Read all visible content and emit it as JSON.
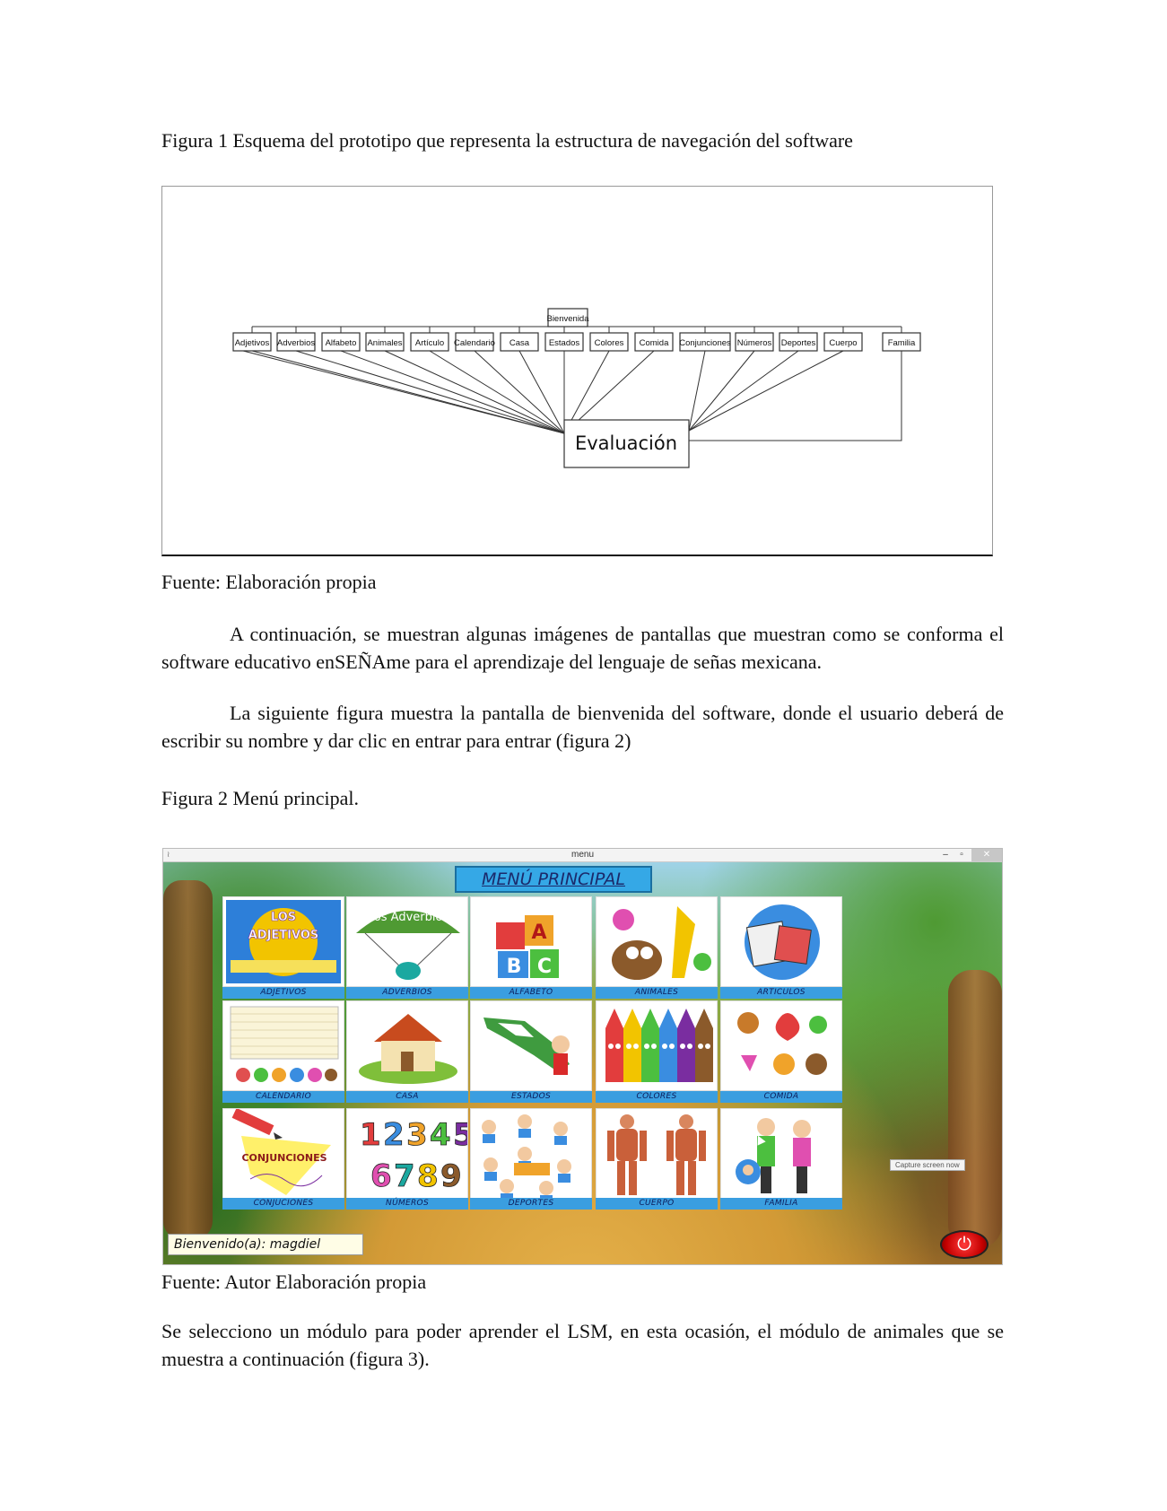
{
  "figure1": {
    "caption": "Figura 1 Esquema del prototipo que representa la estructura de navegación del software",
    "root": "Bienvenida",
    "modules": [
      "Adjetivos",
      "Adverbios",
      "Alfabeto",
      "Animales",
      "Artículo",
      "Calendario",
      "Casa",
      "Estados",
      "Colores",
      "Comida",
      "Conjunciones",
      "Números",
      "Deportes",
      "Cuerpo",
      "Familia"
    ],
    "evaluation": "Evaluación",
    "source": "Fuente: Elaboración propia"
  },
  "paragraphs": {
    "p1": "A continuación, se muestran algunas imágenes de pantallas que muestran como se conforma el software educativo enSEÑAme para el aprendizaje del lenguaje de señas mexicana.",
    "p2": "La siguiente figura muestra la pantalla de bienvenida del software, donde el usuario deberá de escribir su nombre y dar clic en entrar para entrar (figura 2)",
    "p3": "Se selecciono un módulo para poder aprender el LSM, en esta ocasión, el módulo de animales que se  muestra a continuación (figura 3)."
  },
  "figure2": {
    "caption": "Figura 2 Menú principal.",
    "window_title": "menu",
    "window_controls": {
      "minimize": "–",
      "maximize": "▫",
      "close": "✕"
    },
    "menu_title": "MENÚ PRINCIPAL",
    "tiles": [
      {
        "label": "ADJETIVOS",
        "art_text": "LOS ADJETIVOS",
        "icon": "adjectives-icon"
      },
      {
        "label": "ADVERBIOS",
        "art_text": "Los Adverbios",
        "icon": "parachute-icon"
      },
      {
        "label": "ALFABETO",
        "art_text": "ABC",
        "icon": "abc-blocks-icon"
      },
      {
        "label": "ANIMALES",
        "art_text": "",
        "icon": "animals-icon"
      },
      {
        "label": "ARTICULOS",
        "art_text": "",
        "icon": "articles-icon"
      },
      {
        "label": "CALENDARIO",
        "art_text": "",
        "icon": "calendar-icon"
      },
      {
        "label": "CASA",
        "art_text": "",
        "icon": "house-icon"
      },
      {
        "label": "ESTADOS",
        "art_text": "",
        "icon": "mexico-map-icon"
      },
      {
        "label": "COLORES",
        "art_text": "",
        "icon": "crayons-icon"
      },
      {
        "label": "COMIDA",
        "art_text": "",
        "icon": "food-icon"
      },
      {
        "label": "CONJUCIONES",
        "art_text": "CONJUNCIONES",
        "icon": "pencil-icon"
      },
      {
        "label": "NÚMEROS",
        "art_text": "123456789",
        "icon": "numbers-icon"
      },
      {
        "label": "DEPORTES",
        "art_text": "",
        "icon": "sports-icon"
      },
      {
        "label": "CUERPO",
        "art_text": "",
        "icon": "body-icon"
      },
      {
        "label": "FAMILIA",
        "art_text": "",
        "icon": "family-icon"
      }
    ],
    "welcome": "Bienvenido(a): magdiel",
    "tooltip": "Capture screen now",
    "source": "Fuente: Autor Elaboración propia"
  },
  "colors": {
    "tile_label_bg": "#3a9ee0",
    "menu_title_bg": "#35a8e6",
    "power": "#d40000"
  }
}
